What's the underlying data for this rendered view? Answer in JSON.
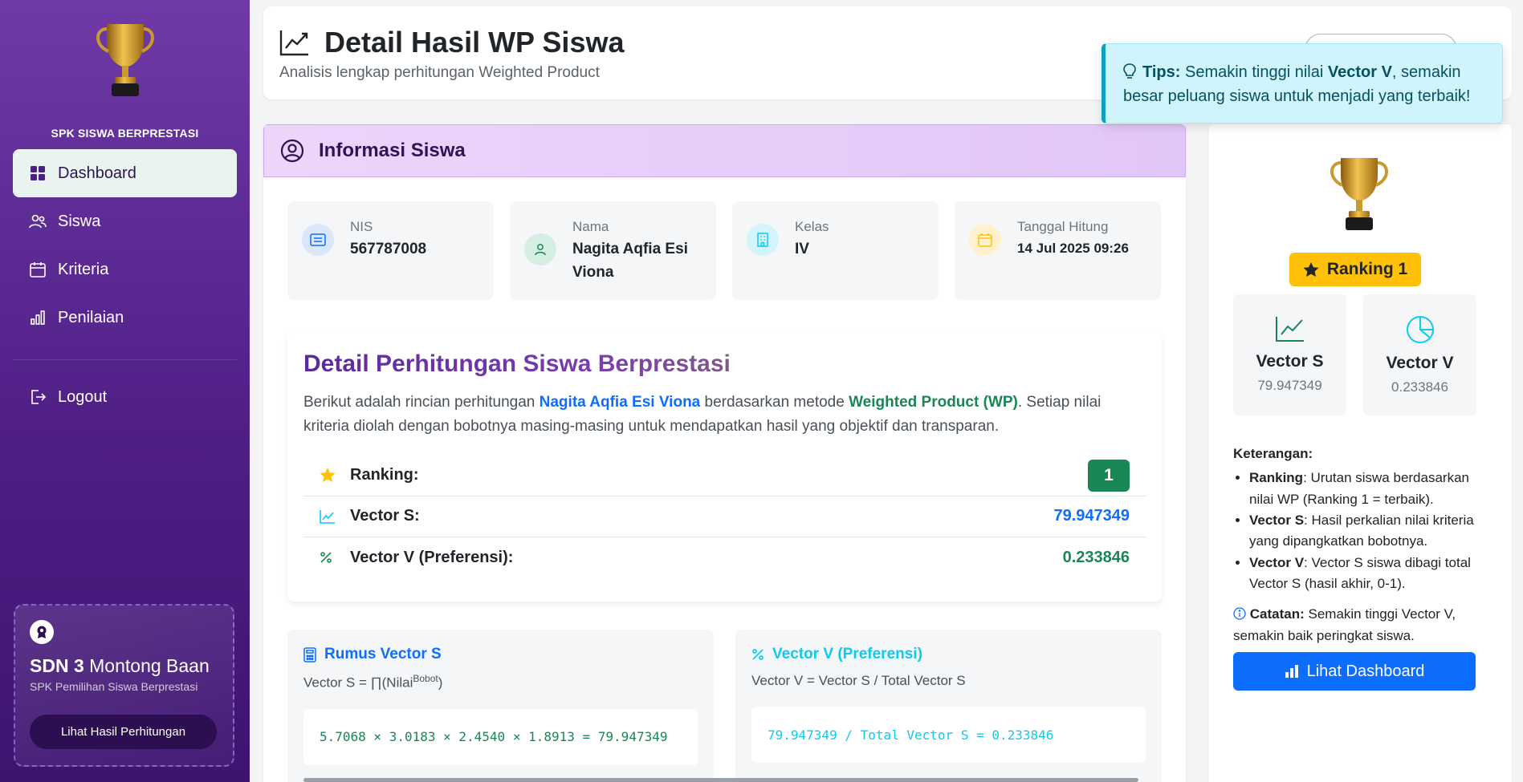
{
  "sidebar": {
    "brand": "SPK SISWA BERPRESTASI",
    "items": [
      {
        "label": "Dashboard",
        "icon": "grid-icon"
      },
      {
        "label": "Siswa",
        "icon": "users-icon"
      },
      {
        "label": "Kriteria",
        "icon": "calendar-icon"
      },
      {
        "label": "Penilaian",
        "icon": "bar-chart-icon"
      }
    ],
    "logout": "Logout",
    "school": {
      "name_bold": "SDN 3",
      "name_rest": "Montong Baan",
      "subtitle": "SPK Pemilihan Siswa Berprestasi",
      "button": "Lihat Hasil Perhitungan"
    }
  },
  "header": {
    "title": "Detail Hasil WP Siswa",
    "subtitle": "Analisis lengkap perhitungan Weighted Product"
  },
  "tips": {
    "label": "Tips:",
    "text_before": "Semakin tinggi nilai",
    "highlight": "Vector V",
    "text_after": ", semakin besar peluang siswa untuk menjadi yang terbaik!"
  },
  "info": {
    "heading": "Informasi Siswa",
    "fields": [
      {
        "label": "NIS",
        "value": "567787008"
      },
      {
        "label": "Nama",
        "value": "Nagita Aqfia Esi Viona"
      },
      {
        "label": "Kelas",
        "value": "IV"
      },
      {
        "label": "Tanggal Hitung",
        "value": "14 Jul 2025 09:26"
      }
    ]
  },
  "detail": {
    "title": "Detail Perhitungan Siswa Berprestasi",
    "p1": "Berikut adalah rincian perhitungan",
    "name": "Nagita Aqfia Esi Viona",
    "p2": "berdasarkan metode",
    "method": "Weighted Product (WP)",
    "p3": ". Setiap nilai kriteria diolah dengan bobotnya masing-masing untuk mendapatkan hasil yang objektif dan transparan.",
    "stats": [
      {
        "label": "Ranking:",
        "value": "1"
      },
      {
        "label": "Vector S:",
        "value": "79.947349"
      },
      {
        "label": "Vector V (Preferensi):",
        "value": "0.233846"
      }
    ]
  },
  "formula_s": {
    "title": "Rumus Vector S",
    "formula_pre": "Vector S = ∏(Nilai",
    "formula_sup": "Bobot",
    "formula_post": ")",
    "calc": "5.7068 × 3.0183 × 2.4540 × 1.8913 = 79.947349"
  },
  "formula_v": {
    "title": "Vector V (Preferensi)",
    "formula": "Vector V = Vector S / Total Vector S",
    "calc": "79.947349 / Total Vector S = 0.233846"
  },
  "right": {
    "rank_label": "Ranking 1",
    "vector_s": {
      "title": "Vector S",
      "value": "79.947349"
    },
    "vector_v": {
      "title": "Vector V",
      "value": "0.233846"
    },
    "notes_title": "Keterangan:",
    "notes": [
      {
        "term": "Ranking",
        "desc": ": Urutan siswa berdasarkan nilai WP (Ranking 1 = terbaik)."
      },
      {
        "term": "Vector S",
        "desc": ": Hasil perkalian nilai kriteria yang dipangkatkan bobotnya."
      },
      {
        "term": "Vector V",
        "desc": ": Vector S siswa dibagi total Vector S (hasil akhir, 0-1)."
      }
    ],
    "catatan_label": "Catatan:",
    "catatan_text": "Semakin tinggi Vector V, semakin baik peringkat siswa.",
    "dashboard_button": "Lihat Dashboard"
  },
  "colors": {
    "sidebar": "#5a2894",
    "accent_blue": "#0d6efd",
    "accent_green": "#198754",
    "accent_cyan": "#0dcaf0",
    "rank_yellow": "#ffc107"
  }
}
